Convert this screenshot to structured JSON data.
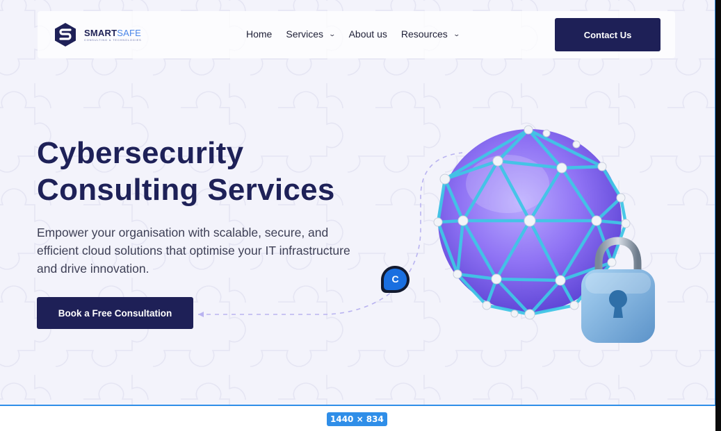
{
  "brand": {
    "name_part1": "SMART",
    "name_part2": "SAFE",
    "tagline": "CONSULTING & TECHNOLOGIES",
    "primary_color": "#1e2057",
    "accent_color": "#4a86e8"
  },
  "nav": {
    "items": [
      {
        "label": "Home",
        "has_dropdown": false
      },
      {
        "label": "Services",
        "has_dropdown": true,
        "icon": "chevron-down-icon"
      },
      {
        "label": "About us",
        "has_dropdown": false
      },
      {
        "label": "Resources",
        "has_dropdown": true,
        "icon": "chevron-down-icon"
      }
    ],
    "contact_label": "Contact Us"
  },
  "hero": {
    "title_line1": "Cybersecurity",
    "title_line2": "Consulting Services",
    "description": "Empower your organisation with scalable, secure, and efficient cloud solutions that optimise your IT infrastructure and drive innovation.",
    "cta_label": "Book a Free Consultation"
  },
  "cursor": {
    "letter": "C",
    "color": "#1a6fe0"
  },
  "artboard": {
    "size_label": "1440 × 834"
  }
}
